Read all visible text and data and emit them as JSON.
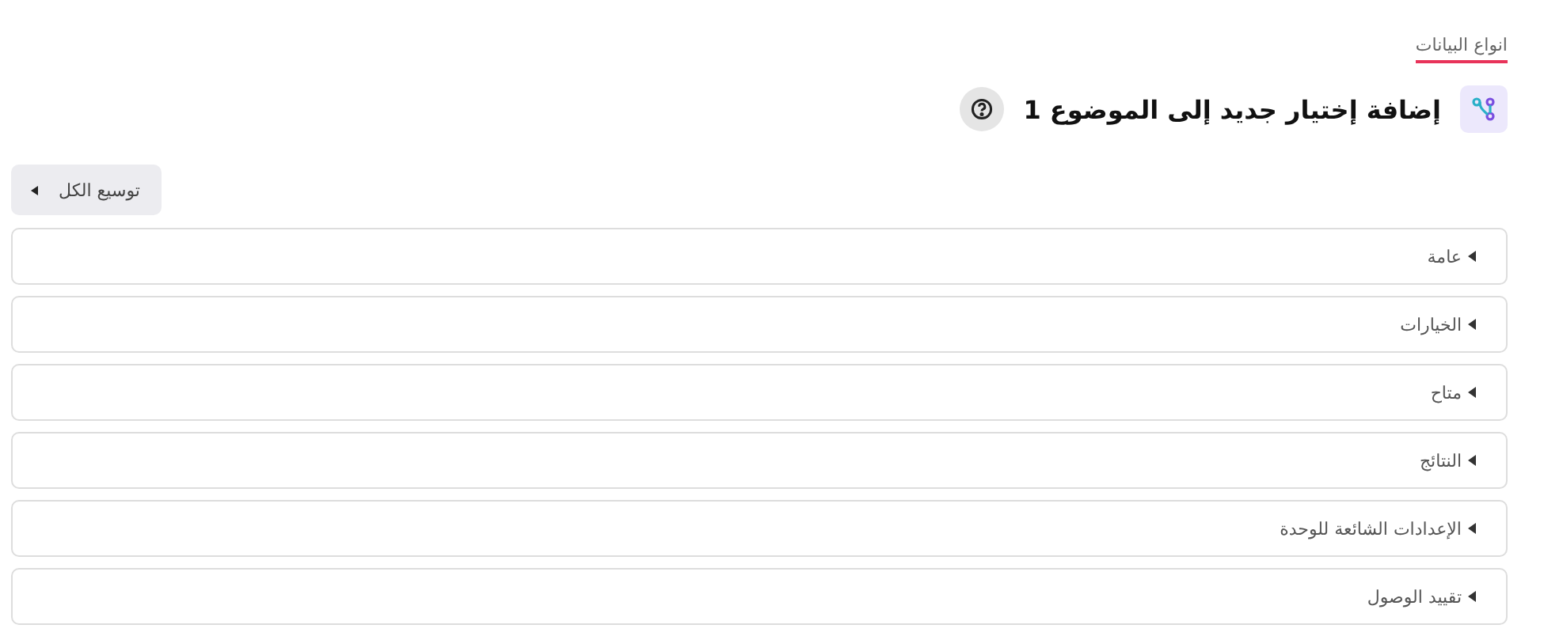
{
  "tabs": [
    {
      "label": "انواع البيانات",
      "selected": true
    }
  ],
  "header": {
    "title": "إضافة إختيار جديد إلى الموضوع 1"
  },
  "expand_all": {
    "label": "توسيع الكل"
  },
  "sections": [
    {
      "label": "عامة",
      "expanded": false
    },
    {
      "label": "الخيارات",
      "expanded": false
    },
    {
      "label": "متاح",
      "expanded": false
    },
    {
      "label": "النتائج",
      "expanded": false
    },
    {
      "label": "الإعدادات الشائعة للوحدة",
      "expanded": false
    },
    {
      "label": "تقييد الوصول",
      "expanded": false
    }
  ]
}
